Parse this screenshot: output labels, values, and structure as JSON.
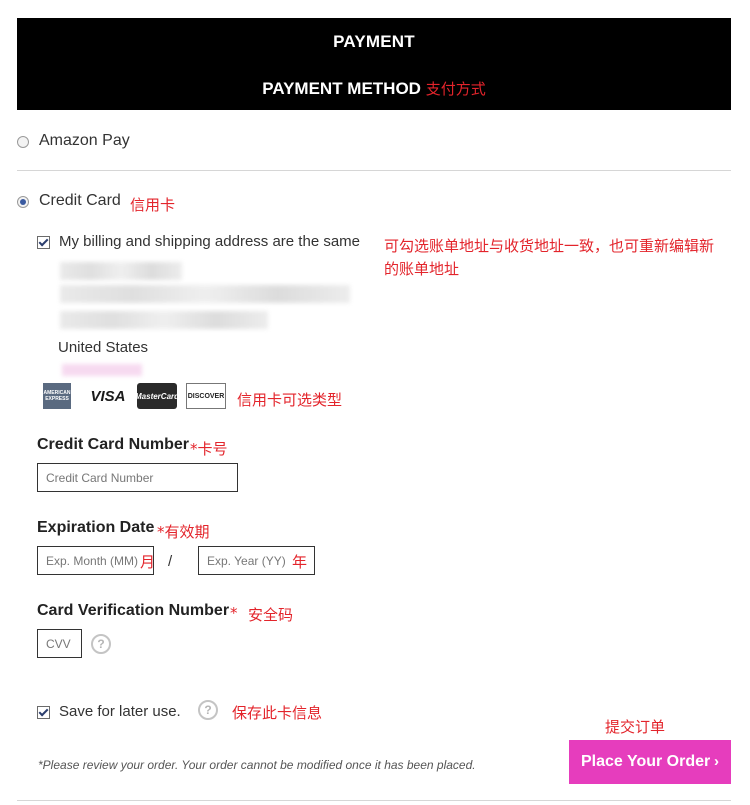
{
  "header": {
    "title": "PAYMENT",
    "subtitle": "PAYMENT METHOD",
    "subtitle_note": "支付方式"
  },
  "payment_options": {
    "amazon_pay": {
      "label": "Amazon Pay",
      "selected": false
    },
    "credit_card": {
      "label": "Credit Card",
      "selected": true,
      "note": "信用卡"
    }
  },
  "billing": {
    "same_address_label": "My billing and shipping address are the same",
    "same_address_checked": true,
    "note_line1": "可勾选账单地址与收货地址一致，也可重新编辑新",
    "note_line2": "的账单地址",
    "country": "United States"
  },
  "cards": {
    "items": [
      "AMERICAN EXPRESS",
      "VISA",
      "MasterCard",
      "DISCOVER"
    ],
    "note": "信用卡可选类型"
  },
  "card_number": {
    "label": "Credit Card Number",
    "required_mark": "*",
    "note": "卡号",
    "placeholder": "Credit Card Number"
  },
  "expiration": {
    "label": "Expiration Date",
    "required_mark": "*",
    "note": "有效期",
    "month_placeholder": "Exp. Month (MM)",
    "month_note": "月",
    "separator": "/",
    "year_placeholder": "Exp. Year (YY)",
    "year_note": "年"
  },
  "cvv": {
    "label": "Card Verification Number",
    "required_mark": "*",
    "note": "安全码",
    "placeholder": "CVV",
    "help": "?"
  },
  "save": {
    "label": "Save for later use.",
    "checked": true,
    "help": "?",
    "note": "保存此卡信息"
  },
  "footer": {
    "disclaimer": "*Please review your order. Your order cannot be modified once it has been placed.",
    "place_order_label": "Place Your Order",
    "place_order_chevron": "›",
    "place_order_note": "提交订单"
  },
  "colors": {
    "header_bg": "#000000",
    "annotation": "#e3242b",
    "button_bg": "#e63dbd"
  }
}
